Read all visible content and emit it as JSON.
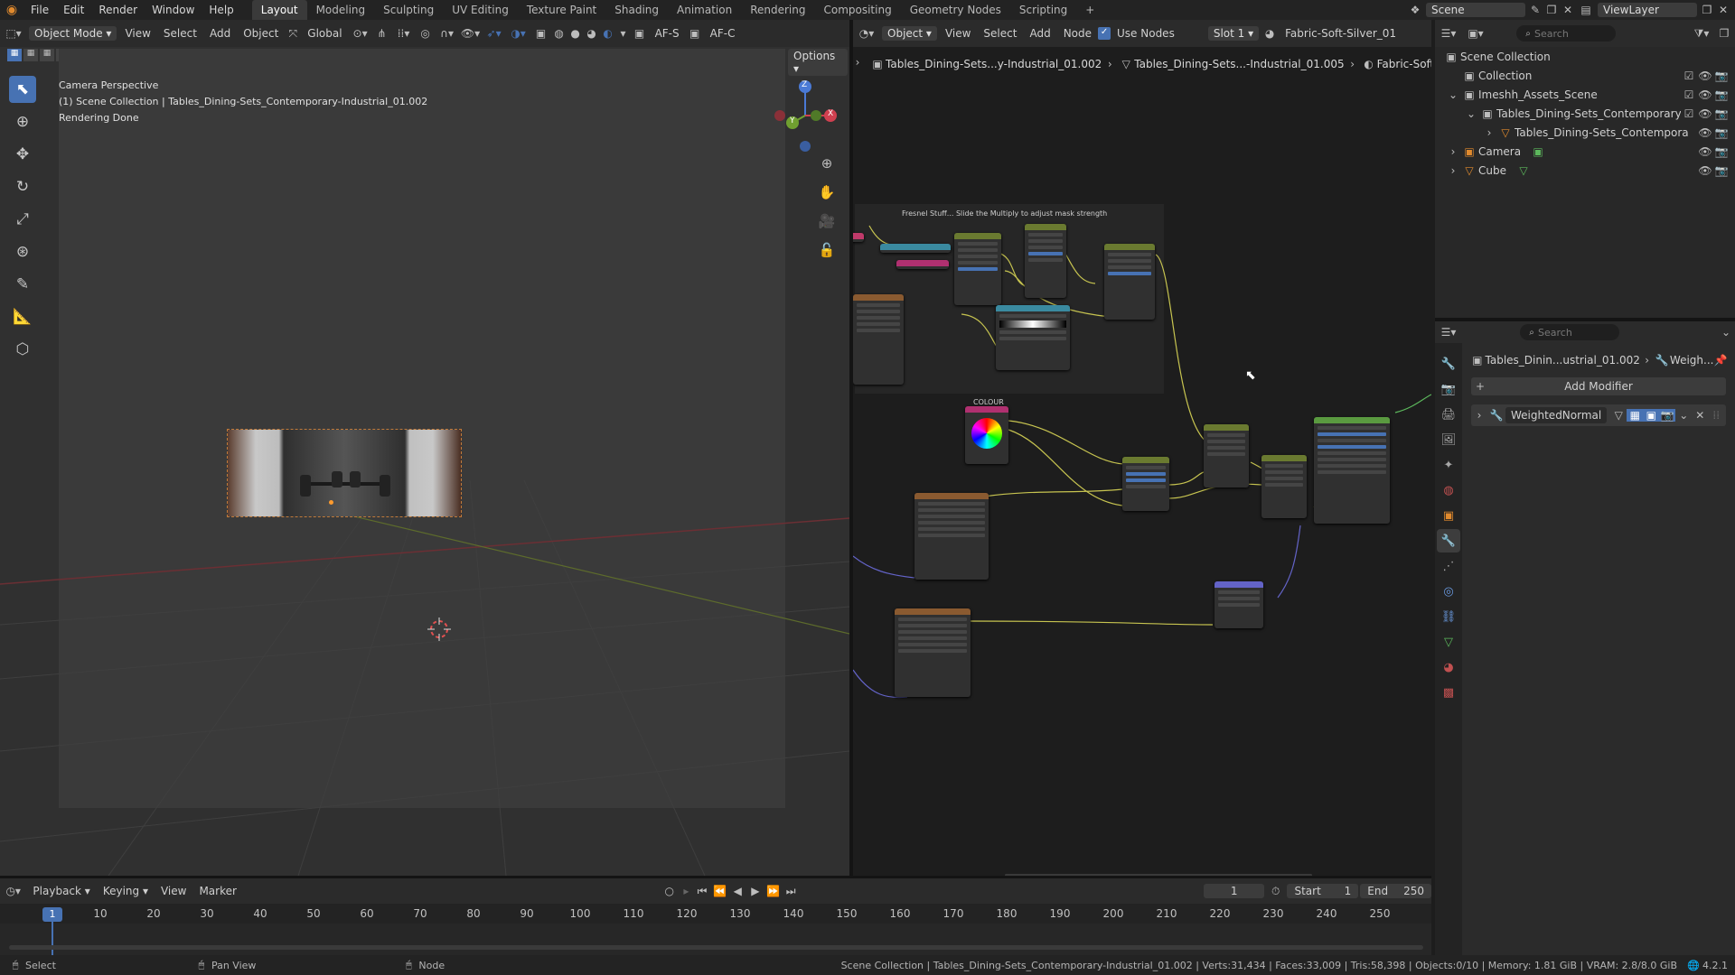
{
  "menu": {
    "items": [
      "File",
      "Edit",
      "Render",
      "Window",
      "Help"
    ]
  },
  "workspaces": {
    "active": "Layout",
    "tabs": [
      "Layout",
      "Modeling",
      "Sculpting",
      "UV Editing",
      "Texture Paint",
      "Shading",
      "Animation",
      "Rendering",
      "Compositing",
      "Geometry Nodes",
      "Scripting"
    ],
    "add": "+"
  },
  "scene": {
    "name": "Scene",
    "view_layer": "ViewLayer"
  },
  "viewport": {
    "mode": "Object Mode",
    "menus": [
      "View",
      "Select",
      "Add",
      "Object"
    ],
    "orientation": "Global",
    "af_s": "AF-S",
    "af_c": "AF-C",
    "options": "Options",
    "overlay_line1": "Camera Perspective",
    "overlay_line2": "(1) Scene Collection | Tables_Dining-Sets_Contemporary-Industrial_01.002",
    "overlay_line3": "Rendering Done",
    "gizmo": {
      "z": "Z",
      "y": "Y",
      "x": "X"
    }
  },
  "node_editor": {
    "type": "Object",
    "menus": [
      "View",
      "Select",
      "Add",
      "Node"
    ],
    "use_nodes": "Use Nodes",
    "slot": "Slot 1",
    "material": "Fabric-Soft-Silver_01",
    "breadcrumb": [
      "Tables_Dining-Sets...y-Industrial_01.002",
      "Tables_Dining-Sets...-Industrial_01.005",
      "Fabric-Soft-Si..."
    ],
    "frame_label": "Fresnel Stuff... Slide the Multiply to adjust mask strength",
    "colour_label": "COLOUR"
  },
  "outliner": {
    "search_placeholder": "Search",
    "items": [
      {
        "label": "Scene Collection"
      },
      {
        "label": "Collection"
      },
      {
        "label": "Imeshh_Assets_Scene"
      },
      {
        "label": "Tables_Dining-Sets_Contemporary-"
      },
      {
        "label": "Tables_Dining-Sets_Contempora"
      },
      {
        "label": "Camera"
      },
      {
        "label": "Cube"
      }
    ]
  },
  "properties": {
    "search_placeholder": "Search",
    "object": "Tables_Dinin...ustrial_01.002",
    "modifier_crumb": "Weigh...",
    "add_modifier": "Add Modifier",
    "modifier_name": "WeightedNormal"
  },
  "timeline": {
    "menus": [
      "Playback",
      "Keying",
      "View",
      "Marker"
    ],
    "current_frame": "1",
    "start_label": "Start",
    "start": "1",
    "end_label": "End",
    "end": "250",
    "playhead": "1",
    "ticks": [
      "10",
      "20",
      "30",
      "40",
      "50",
      "60",
      "70",
      "80",
      "90",
      "100",
      "110",
      "120",
      "130",
      "140",
      "150",
      "160",
      "170",
      "180",
      "190",
      "200",
      "210",
      "220",
      "230",
      "240",
      "250"
    ]
  },
  "status_bar": {
    "select": "Select",
    "pan": "Pan View",
    "node": "Node",
    "info": "Scene Collection | Tables_Dining-Sets_Contemporary-Industrial_01.002 | Verts:31,434 | Faces:33,009 | Tris:58,398 | Objects:0/10 | Memory: 1.81 GiB | VRAM: 2.8/8.0 GiB",
    "version": "4.2.1"
  },
  "colors": {
    "accent": "#4772b3",
    "header": "#2b2b2b",
    "background": "#1d1d1d",
    "node_yellow": "#c7c450",
    "node_purple": "#6363c7"
  }
}
